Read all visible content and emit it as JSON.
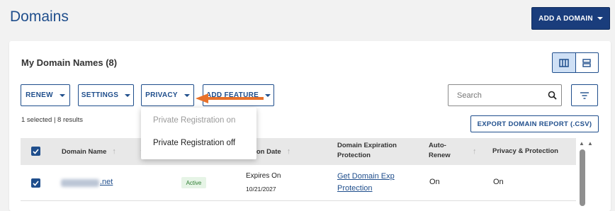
{
  "header": {
    "title": "Domains",
    "add_domain_label": "ADD A DOMAIN"
  },
  "card": {
    "title": "My Domain Names (8)"
  },
  "toolbar": {
    "renew_label": "RENEW",
    "settings_label": "SETTINGS",
    "privacy_label": "PRIVACY",
    "add_feature_label": "ADD FEATURE",
    "search_placeholder": "Search",
    "export_label": "EXPORT DOMAIN REPORT (.CSV)"
  },
  "selection_info": "1 selected | 8 results",
  "privacy_menu": {
    "items": [
      {
        "label": "Private Registration on",
        "enabled": false
      },
      {
        "label": "Private Registration off",
        "enabled": true
      }
    ]
  },
  "table": {
    "columns": {
      "domain_name": "Domain Name",
      "expiration_date": "Expiration Date",
      "expiration_protection_line1": "Domain Expiration",
      "expiration_protection_line2": "Protection",
      "auto_renew_line1": "Auto-",
      "auto_renew_line2": "Renew",
      "privacy": "Privacy & Protection"
    },
    "rows": [
      {
        "domain_suffix": ".net",
        "status": "Active",
        "expires_label": "Expires On",
        "expires_date": "10/21/2027",
        "protection_line1": "Get Domain Exp",
        "protection_line2": "Protection",
        "auto_renew": "On",
        "privacy": "On"
      }
    ]
  },
  "colors": {
    "brand_blue": "#1f4e8c",
    "annotation_orange": "#e8712a"
  }
}
